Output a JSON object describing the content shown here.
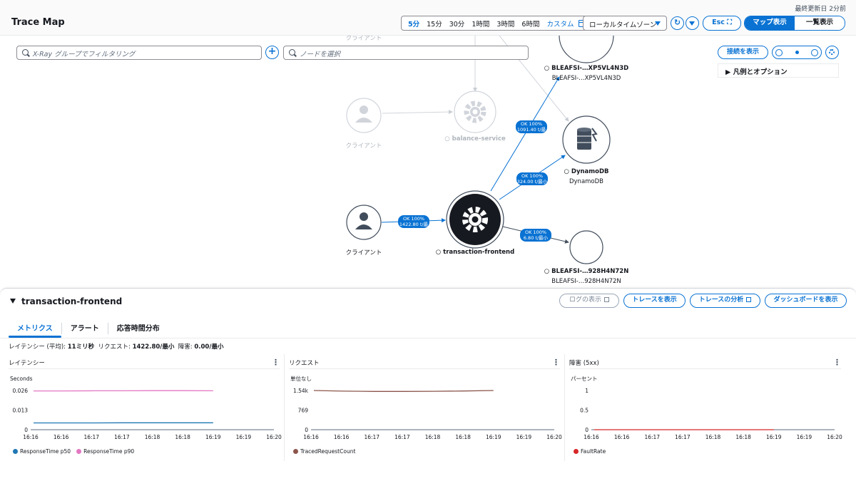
{
  "header": {
    "title": "Trace Map",
    "last_updated": "最終更新日 2分前",
    "time_ranges": [
      {
        "label": "5分",
        "active": true
      },
      {
        "label": "15分",
        "active": false
      },
      {
        "label": "30分",
        "active": false
      },
      {
        "label": "1時間",
        "active": false
      },
      {
        "label": "3時間",
        "active": false
      },
      {
        "label": "6時間",
        "active": false
      },
      {
        "label": "カスタム",
        "active": false
      }
    ],
    "timezone": "ローカルタイムゾーン",
    "esc_label": "Esc",
    "view_modes": [
      {
        "label": "マップ表示",
        "active": true
      },
      {
        "label": "一覧表示",
        "active": false
      }
    ]
  },
  "map": {
    "group_filter_placeholder": "X-Ray グループでフィルタリング",
    "node_select_placeholder": "ノードを選択",
    "show_connections_label": "接続を表示",
    "legend_label": "凡例とオプション",
    "nodes": [
      {
        "id": "client-top",
        "label": "クライアント"
      },
      {
        "id": "client-dim",
        "label": "クライアント"
      },
      {
        "id": "balance",
        "label": "balance-service"
      },
      {
        "id": "bleafsi1",
        "label": "BLEAFSI-…XP5VL4N3D",
        "sublabel": "BLEAFSI-…XP5VL4N3D"
      },
      {
        "id": "dynamo",
        "label": "DynamoDB",
        "sublabel": "DynamoDB"
      },
      {
        "id": "client",
        "label": "クライアント"
      },
      {
        "id": "frontend",
        "label": "transaction-frontend"
      },
      {
        "id": "bleafsi2",
        "label": "BLEAFSI-…928H4N72N",
        "sublabel": "BLEAFSI-…928H4N72N"
      }
    ],
    "edges": [
      {
        "line1": "OK 100%",
        "line2": "1422.80 t/最小"
      },
      {
        "line1": "OK 100%",
        "line2": "1091.40 t/最小"
      },
      {
        "line1": "OK 100%",
        "line2": "324.00 t/最小"
      },
      {
        "line1": "OK 100%",
        "line2": "6.80 t/最小"
      }
    ]
  },
  "panel": {
    "title": "transaction-frontend",
    "buttons": {
      "logs": "ログの表示",
      "traces": "トレースを表示",
      "analyze": "トレースの分析",
      "dashboard": "ダッシュボードを表示"
    },
    "tabs": [
      {
        "label": "メトリクス",
        "active": true
      },
      {
        "label": "アラート",
        "active": false
      },
      {
        "label": "応答時間分布",
        "active": false
      }
    ],
    "summary": {
      "latency_label": "レイテンシー (平均):",
      "latency_value": "11ミリ秒",
      "requests_label": "リクエスト:",
      "requests_value": "1422.80/最小",
      "faults_label": "障害:",
      "faults_value": "0.00/最小"
    }
  },
  "chart_data": [
    {
      "type": "line",
      "title": "レイテンシー",
      "ylabel": "Seconds",
      "x": [
        "16:16",
        "16:16",
        "16:17",
        "16:17",
        "16:18",
        "16:18",
        "16:19",
        "16:19",
        "16:20"
      ],
      "yticks": [
        "0.026",
        "0.013",
        "0"
      ],
      "ylim": [
        0,
        0.026
      ],
      "series": [
        {
          "name": "ResponseTime p50",
          "color": "#1f77b4",
          "values": [
            0.0045,
            0.0045,
            0.0045,
            0.0046,
            0.0046,
            0.0046,
            0.0046
          ]
        },
        {
          "name": "ResponseTime p90",
          "color": "#e377c2",
          "values": [
            0.0257,
            0.0257,
            0.0258,
            0.0258,
            0.0259,
            0.0259,
            0.0258
          ]
        }
      ]
    },
    {
      "type": "line",
      "title": "リクエスト",
      "ylabel": "単位なし",
      "x": [
        "16:16",
        "16:16",
        "16:17",
        "16:17",
        "16:18",
        "16:18",
        "16:19",
        "16:19",
        "16:20"
      ],
      "yticks": [
        "1.54k",
        "769",
        "0"
      ],
      "ylim": [
        0,
        1540
      ],
      "series": [
        {
          "name": "TracedRequestCount",
          "color": "#8c564b",
          "values": [
            1540,
            1515,
            1505,
            1505,
            1510,
            1520,
            1540
          ]
        }
      ]
    },
    {
      "type": "line",
      "title": "障害 (5xx)",
      "ylabel": "パーセント",
      "x": [
        "16:16",
        "16:16",
        "16:17",
        "16:17",
        "16:18",
        "16:18",
        "16:19",
        "16:19",
        "16:20"
      ],
      "yticks": [
        "1",
        "0.5",
        "0"
      ],
      "ylim": [
        0,
        1
      ],
      "series": [
        {
          "name": "FaultRate",
          "color": "#d62728",
          "values": [
            0,
            0,
            0,
            0,
            0,
            0,
            0
          ]
        }
      ]
    }
  ]
}
